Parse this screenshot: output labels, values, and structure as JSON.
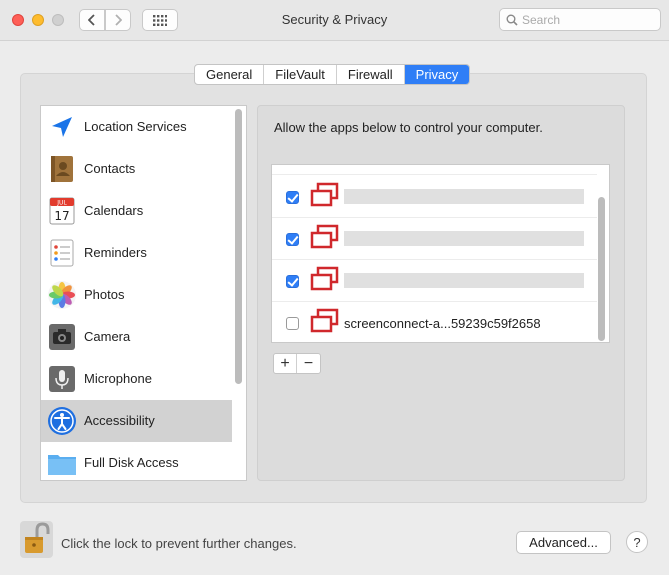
{
  "window": {
    "title": "Security & Privacy",
    "search_placeholder": "Search"
  },
  "toolbar": {
    "back_icon": "chevron-left-icon",
    "forward_icon": "chevron-right-icon",
    "show_all_icon": "grid-icon"
  },
  "tabs": [
    {
      "label": "General",
      "active": false
    },
    {
      "label": "FileVault",
      "active": false
    },
    {
      "label": "Firewall",
      "active": false
    },
    {
      "label": "Privacy",
      "active": true
    }
  ],
  "sidebar": {
    "items": [
      {
        "label": "Location Services",
        "icon": "location-arrow-icon"
      },
      {
        "label": "Contacts",
        "icon": "contacts-book-icon"
      },
      {
        "label": "Calendars",
        "icon": "calendar-icon",
        "icon_month": "JUL",
        "icon_day": "17"
      },
      {
        "label": "Reminders",
        "icon": "reminders-list-icon"
      },
      {
        "label": "Photos",
        "icon": "photos-flower-icon"
      },
      {
        "label": "Camera",
        "icon": "camera-icon"
      },
      {
        "label": "Microphone",
        "icon": "microphone-icon"
      },
      {
        "label": "Accessibility",
        "icon": "accessibility-icon",
        "selected": true
      },
      {
        "label": "Full Disk Access",
        "icon": "folder-icon"
      }
    ]
  },
  "content": {
    "description": "Allow the apps below to control your computer.",
    "apps": [
      {
        "name": "",
        "checked": true,
        "redacted": true
      },
      {
        "name": "",
        "checked": true,
        "redacted": true
      },
      {
        "name": "",
        "checked": true,
        "redacted": true
      },
      {
        "name": "screenconnect-a...59239c59f2658",
        "checked": false,
        "redacted": false
      }
    ],
    "add_label": "+",
    "remove_label": "−"
  },
  "footer": {
    "lock_text": "Click the lock to prevent further changes.",
    "advanced_label": "Advanced...",
    "help_label": "?"
  },
  "colors": {
    "accent": "#2f7ef6",
    "app_icon_red": "#d0282c"
  }
}
